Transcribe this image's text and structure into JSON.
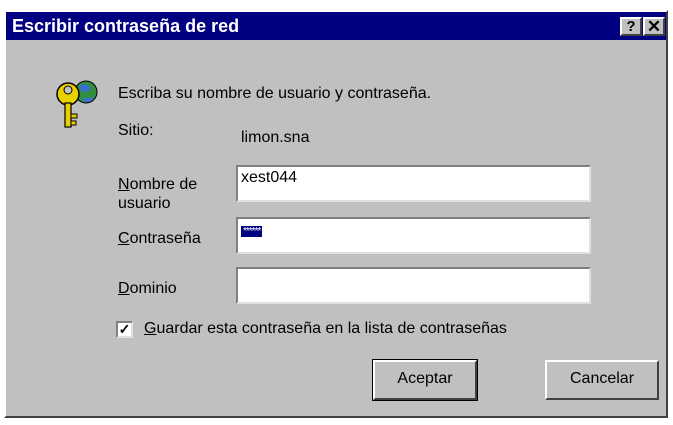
{
  "window": {
    "title": "Escribir contraseña de red",
    "help_glyph": "?",
    "close_glyph": "✕"
  },
  "icon": "keys-globe-icon",
  "prompt": "Escriba su nombre de usuario y contraseña.",
  "site": {
    "label": "Sitio:",
    "value": "limon.sna"
  },
  "fields": {
    "username": {
      "label_first": "N",
      "label_rest": "ombre de",
      "label_line2": "usuario",
      "value": "xest044"
    },
    "password": {
      "label_first": "C",
      "label_rest": "ontraseña",
      "value": "******"
    },
    "domain": {
      "label_first": "D",
      "label_rest": "ominio",
      "value": ""
    }
  },
  "save_password": {
    "checked": true,
    "check_glyph": "✓",
    "label_first": "G",
    "label_rest": "uardar esta contraseña en la lista de contraseñas"
  },
  "buttons": {
    "ok": "Aceptar",
    "cancel": "Cancelar"
  },
  "colors": {
    "titlebar": "#000080",
    "face": "#c0c0c0",
    "selection": "#000080"
  }
}
